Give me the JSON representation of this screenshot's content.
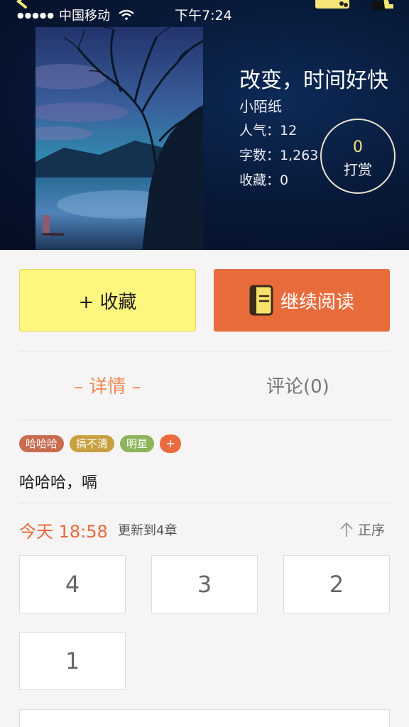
{
  "status_bar": {
    "carrier": "中国移动",
    "time": "下午7:24"
  },
  "book": {
    "title": "改变，时间好快",
    "author": "小陌纸",
    "popularity": "人气：12",
    "word_count": "字数：1,263",
    "favorites": "收藏：0"
  },
  "reward": {
    "count": "0",
    "label": "打赏"
  },
  "actions": {
    "collect": "+ 收藏",
    "read": "继续阅读"
  },
  "tabs": {
    "details": "– 详情 –",
    "comments": "评论(0)"
  },
  "tags": [
    {
      "label": "哈哈哈",
      "color": "#c96b4e"
    },
    {
      "label": "搞不清",
      "color": "#c9a03f"
    },
    {
      "label": "明星",
      "color": "#8cb45b"
    }
  ],
  "tag_add": "+",
  "intro": "哈哈哈，嗝",
  "update": {
    "time": "今天 18:58",
    "text": "更新到4章",
    "sort": "正序"
  },
  "chapters": [
    "4",
    "3",
    "2",
    "1"
  ],
  "colors": {
    "accent": "#e86b3c",
    "collect_bg": "#fdf67f",
    "reward_number": "#f2e37a"
  }
}
